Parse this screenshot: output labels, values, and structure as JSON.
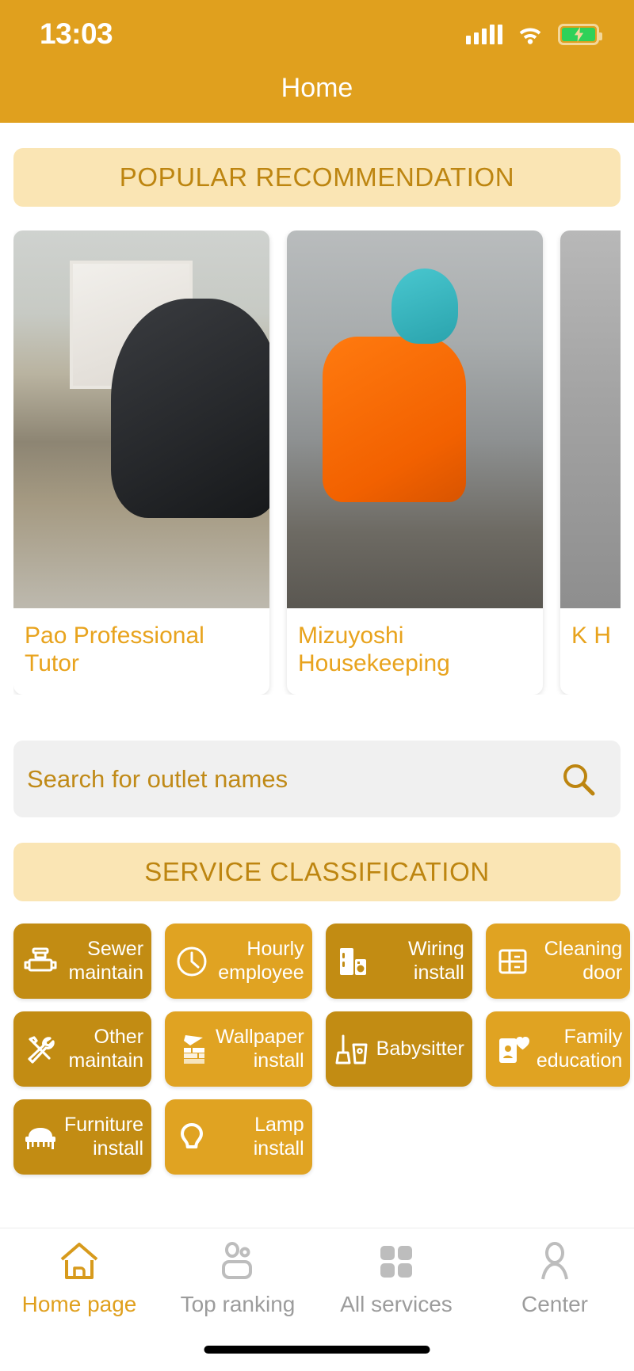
{
  "statusbar": {
    "time": "13:03",
    "signal_icon": "cellular-signal-icon",
    "wifi_icon": "wifi-icon",
    "battery_icon": "battery-charging-icon"
  },
  "header": {
    "title": "Home",
    "background_color": "#e0a01e"
  },
  "sections": {
    "popular": {
      "banner_label": "POPULAR RECOMMENDATION"
    },
    "classification": {
      "banner_label": "SERVICE CLASSIFICATION"
    }
  },
  "recommendations": [
    {
      "title": "Pao Professional Tutor",
      "image_name": "tutor-photo"
    },
    {
      "title": "Mizuyoshi Housekeeping",
      "image_name": "housekeeping-photo"
    },
    {
      "title": "K H",
      "image_name": "third-photo"
    }
  ],
  "search": {
    "placeholder": "Search for outlet names",
    "value": "",
    "icon": "search-icon"
  },
  "services": [
    {
      "label": "Sewer maintain",
      "icon": "sewer-pipe-icon",
      "tone": "dark"
    },
    {
      "label": "Hourly employee",
      "icon": "clock-icon",
      "tone": "light"
    },
    {
      "label": "Wiring install",
      "icon": "appliance-icon",
      "tone": "dark"
    },
    {
      "label": "Cleaning door",
      "icon": "window-grid-icon",
      "tone": "light"
    },
    {
      "label": "Other maintain",
      "icon": "tools-icon",
      "tone": "dark"
    },
    {
      "label": "Wallpaper install",
      "icon": "trowel-brick-icon",
      "tone": "light"
    },
    {
      "label": "Babysitter",
      "icon": "broom-bucket-icon",
      "tone": "dark"
    },
    {
      "label": "Family education",
      "icon": "person-heart-icon",
      "tone": "light"
    },
    {
      "label": "Furniture install",
      "icon": "bed-icon",
      "tone": "dark"
    },
    {
      "label": "Lamp install",
      "icon": "bulb-icon",
      "tone": "light"
    }
  ],
  "tabbar": {
    "items": [
      {
        "label": "Home page",
        "icon": "home-icon",
        "active": true
      },
      {
        "label": "Top ranking",
        "icon": "people-icon",
        "active": false
      },
      {
        "label": "All services",
        "icon": "grid-icon",
        "active": false
      },
      {
        "label": "Center",
        "icon": "user-icon",
        "active": false
      }
    ]
  },
  "colors": {
    "brand": "#e0a01e",
    "banner_bg": "#fae5b4",
    "banner_text": "#bd8510",
    "tile_dark": "#c28c13",
    "tile_light": "#e0a322",
    "inactive": "#9c9c9c"
  }
}
